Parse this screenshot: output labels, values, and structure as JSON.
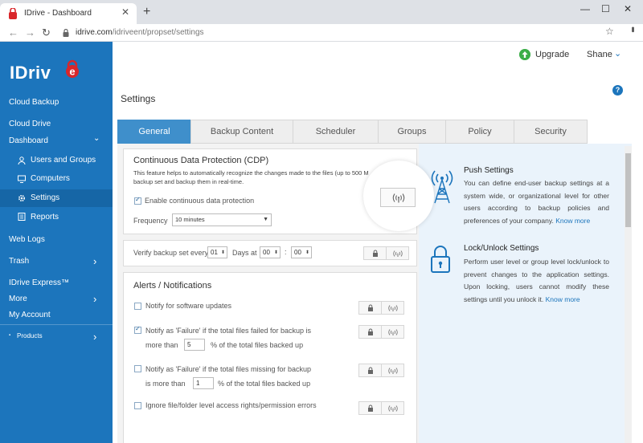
{
  "browser": {
    "tab_title": "IDrive - Dashboard",
    "tab_close": "✕",
    "new_tab": "+",
    "url_host": "idrive.com",
    "url_path": "/idriveent/propset/settings",
    "win_min": "—",
    "win_max": "☐",
    "win_close": "✕",
    "back": "←",
    "forward": "→",
    "reload": "↻",
    "star": "☆",
    "menu": "•••"
  },
  "sidebar": {
    "logo": "IDriv",
    "logo_e": "e",
    "items": {
      "cloud_backup": "Cloud Backup",
      "cloud_drive": "Cloud Drive",
      "dashboard": "Dashboard",
      "users_groups": "Users and Groups",
      "computers": "Computers",
      "settings": "Settings",
      "reports": "Reports",
      "web_logs": "Web Logs",
      "trash": "Trash",
      "idrive_express": "IDrive Express™",
      "more": "More",
      "my_account": "My Account",
      "products": "Products"
    },
    "chev_down": "⌄",
    "chev_right": "›",
    "bullet": "▪"
  },
  "header": {
    "upgrade": "Upgrade",
    "user": "Shane",
    "user_chev": "⌄",
    "help": "?",
    "page_title": "Settings"
  },
  "tabs": [
    "General",
    "Backup Content",
    "Scheduler",
    "Groups",
    "Policy",
    "Security"
  ],
  "cdp": {
    "title": "Continuous Data Protection (CDP)",
    "desc_line1": "This feature helps to automatically recognize the changes made to the files (up to 500 M",
    "desc_line2": "backup set and backup them in real-time.",
    "enable_label": "Enable continuous data protection",
    "frequency_label": "Frequency",
    "frequency_value": "10 minutes"
  },
  "verify": {
    "label": "Verify backup set every",
    "days_value": "01",
    "days_label": "Days at",
    "hour": "00",
    "colon": ":",
    "minute": "00"
  },
  "alerts": {
    "title": "Alerts / Notifications",
    "software_updates": "Notify for software updates",
    "failed_line1": "Notify as 'Failure' if the total files failed for backup is",
    "failed_more": "more than",
    "failed_value": "5",
    "failed_suffix": "% of the total files backed up",
    "missing_line1": "Notify as 'Failure' if the total files missing for backup",
    "missing_more": "is more than",
    "missing_value": "1",
    "missing_suffix": "% of the total files backed up",
    "ignore": "Ignore file/folder level access rights/permission errors"
  },
  "info": {
    "push_title": "Push Settings",
    "push_text": "You can define end-user backup settings at a system wide, or organizational level for other users according to backup policies and preferences of your company.",
    "lock_title": "Lock/Unlock Settings",
    "lock_text": "Perform user level or group level lock/unlock to prevent changes to the application settings. Upon locking, users cannot modify these settings until you unlock it.",
    "know_more": "Know more"
  },
  "colors": {
    "sidebar": "#1c75bc",
    "active_tab": "#3f8fcb",
    "link": "#1c75bc",
    "upgrade": "#3cae49"
  }
}
